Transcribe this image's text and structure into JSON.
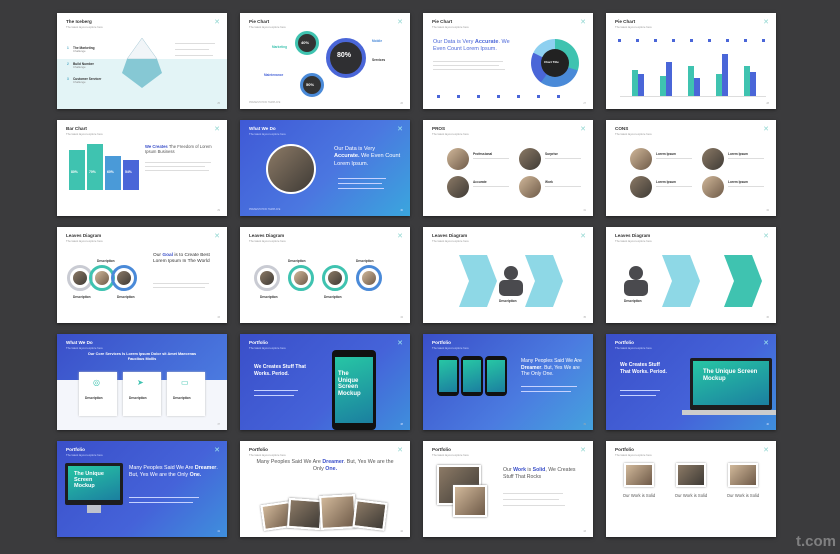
{
  "slides": [
    {
      "title": "The Iceberg",
      "sub": "The latest layout explore here",
      "items": [
        {
          "num": "1",
          "title": "The Marketing",
          "desc": "Challenge"
        },
        {
          "num": "2",
          "title": "Build Number",
          "desc": "Challenge"
        },
        {
          "num": "3",
          "title": "Customer Servicer",
          "desc": "Challenge"
        }
      ]
    },
    {
      "title": "Pie Chart",
      "sub": "The latest layout explore here",
      "pcts": [
        "40%",
        "80%",
        "50%"
      ],
      "labels": [
        "Marketing",
        "Maintenance",
        "Mobile",
        "Services"
      ]
    },
    {
      "title": "Pie Chart",
      "sub": "The latest layout explore here",
      "heading": "Our Data is Very",
      "heading_bold": "Accurate",
      "heading2": ". We Even Count Lorem Ipsum.",
      "center": "Chart Title"
    },
    {
      "title": "Pie Chart",
      "sub": "The latest layout explore here"
    },
    {
      "title": "Bar Chart",
      "sub": "The latest layout explore here",
      "pcts": [
        "80%",
        "70%",
        "60%",
        "54%"
      ],
      "heading": "We Creates",
      "heading2": " The Freedom of Lorem Ipsum Business"
    },
    {
      "title": "What We Do",
      "sub": "The latest layout explore here",
      "heading": "Our Data is Very",
      "heading_bold": "Accurate.",
      "heading2": " We Even Count Lorem Ipsum."
    },
    {
      "title": "PROS",
      "sub": "The latest layout explore here",
      "items": [
        "Professional",
        "Surprise",
        "Accurate",
        "Work"
      ]
    },
    {
      "title": "CONS",
      "sub": "The latest layout explore here",
      "items": [
        "Lorem Ipsum",
        "Lorem Ipsum",
        "Lorem Ipsum",
        "Lorem Ipsum"
      ]
    },
    {
      "title": "Leaves Diagram",
      "sub": "The latest layout explore here",
      "heading": "Our",
      "heading_bold": "Goal",
      "heading2": " is to Create Best Lorem Ipsum In The World",
      "desc": "Description"
    },
    {
      "title": "Leaves Diagram",
      "sub": "The latest layout explore here",
      "desc": "Description"
    },
    {
      "title": "Leaves Diagram",
      "sub": "The latest layout explore here",
      "desc": "Description"
    },
    {
      "title": "Leaves Diagram",
      "sub": "The latest layout explore here",
      "desc": "Description"
    },
    {
      "title": "What We Do",
      "sub": "The latest layout explore here",
      "heading": "Our Core Services Is Lorem Ipsum Dolor sit Amet Maecenas Faucibus Mollis",
      "desc": "Description"
    },
    {
      "title": "Portfolio",
      "sub": "The latest layout explore here",
      "heading": "We Creates Stuff That Works. Period.",
      "screen": "The Unique Screen Mockup"
    },
    {
      "title": "Portfolio",
      "sub": "The latest layout explore here",
      "heading": "Many Peoples Said We Are",
      "heading_bold": "Dreamer",
      "heading2": ". But, Yes We are The Only One."
    },
    {
      "title": "Portfolio",
      "sub": "The latest layout explore here",
      "heading": "We Creates Stuff That Works. Period.",
      "screen": "The Unique Screen Mockup"
    },
    {
      "title": "Portfolio",
      "sub": "The latest layout explore here",
      "heading": "Many Peoples Said We Are",
      "heading_bold": "Dreamer",
      "heading2": ". But, Yes We are the Only",
      "heading_bold2": "One.",
      "screen": "The Unique Screen Mockup"
    },
    {
      "title": "Portfolio",
      "sub": "The latest layout explore here",
      "heading": "Many Peoples Said We Are",
      "heading_bold": "Dreamer",
      "heading2": ". But, Yes We are the Only",
      "heading_bold2": "One."
    },
    {
      "title": "Portfolio",
      "sub": "The latest layout explore here",
      "heading": "Our",
      "heading_bold": "Work",
      "heading2": " is",
      "heading_bold2": "Solid",
      "heading3": ", We Creates Stuff That Rocks"
    },
    {
      "title": "Portfolio",
      "sub": "The latest layout explore here",
      "captions": [
        "Our Work is Solid",
        "Our Work is Solid",
        "Our Work is Solid"
      ]
    }
  ],
  "footer": "PRESENTATION TEMPLATE",
  "watermark": "t.com",
  "colors": {
    "teal": "#3fc3b0",
    "blue": "#4a66d8",
    "navy": "#3a4fc9",
    "bg": "#3b3b3d"
  }
}
